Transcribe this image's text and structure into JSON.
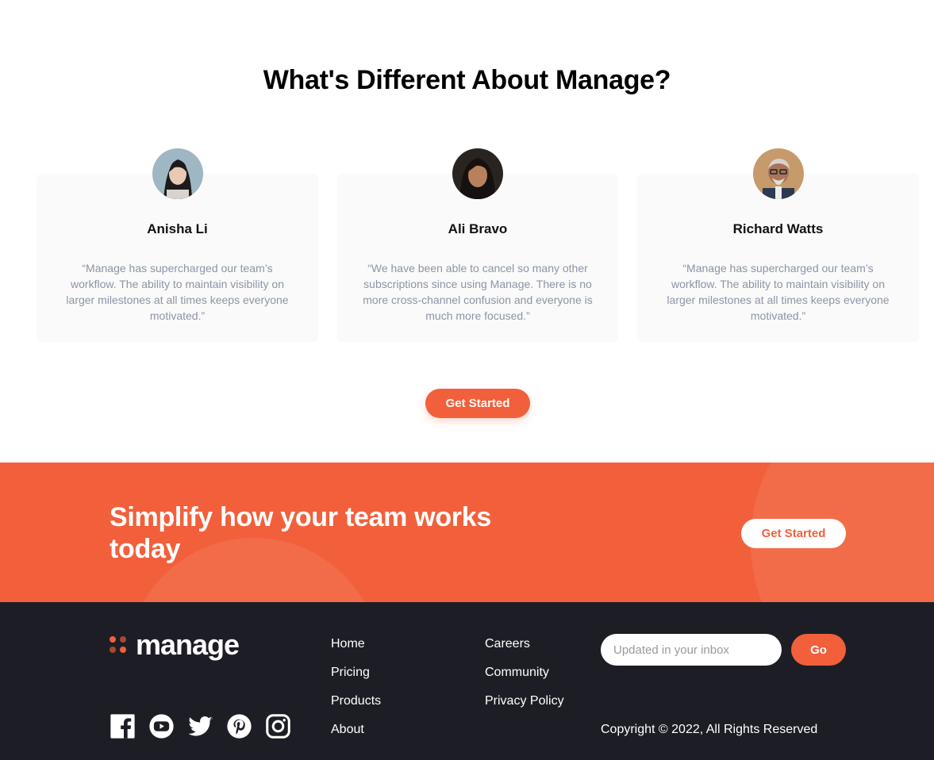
{
  "section": {
    "title": "What's Different About Manage?"
  },
  "testimonials": [
    {
      "name": "Anisha Li",
      "quote": "“Manage has supercharged our team’s workflow. The ability to maintain visibility on larger milestones at all times keeps everyone motivated.”"
    },
    {
      "name": "Ali Bravo",
      "quote": "“We have been able to cancel so many other subscriptions since using Manage. There is no more cross-channel confusion and everyone is much more focused.”"
    },
    {
      "name": "Richard Watts",
      "quote": "“Manage has supercharged our team’s workflow. The ability to maintain visibility on larger milestones at all times keeps everyone motivated.”"
    }
  ],
  "primary_cta": {
    "label": "Get Started"
  },
  "cta_banner": {
    "title": "Simplify how your team works today",
    "button_label": "Get Started"
  },
  "footer": {
    "logo_text": "manage",
    "socials": [
      "facebook-icon",
      "youtube-icon",
      "twitter-icon",
      "pinterest-icon",
      "instagram-icon"
    ],
    "links_col1": [
      "Home",
      "Pricing",
      "Products",
      "About"
    ],
    "links_col2": [
      "Careers",
      "Community",
      "Privacy Policy"
    ],
    "newsletter": {
      "placeholder": "Updated in your inbox",
      "button_label": "Go"
    },
    "copyright": "Copyright © 2022, All Rights Reserved"
  },
  "colors": {
    "accent": "#f2603b",
    "footer_bg": "#1d1e25",
    "card_bg": "#fafafa"
  }
}
